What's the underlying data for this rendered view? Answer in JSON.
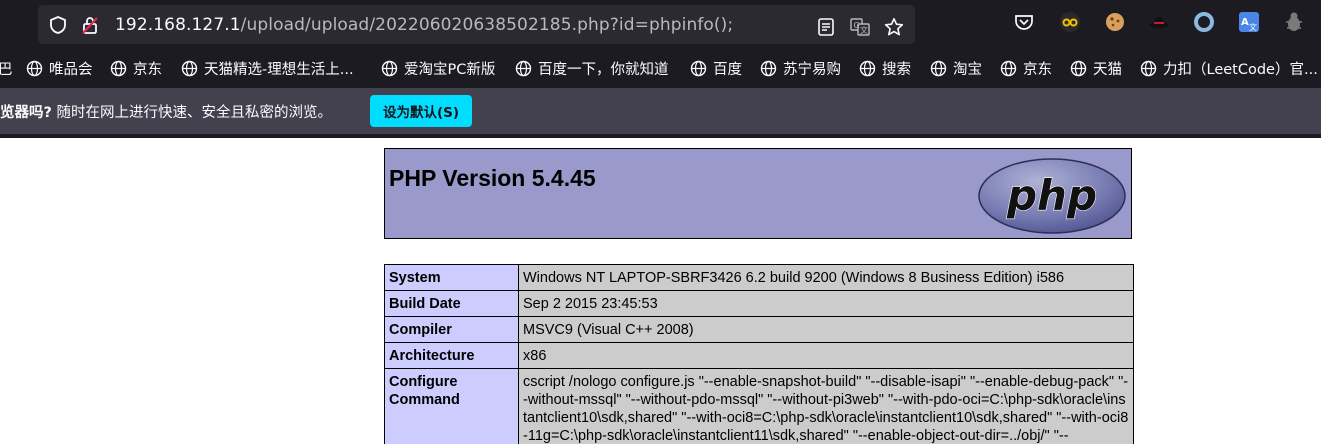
{
  "browser": {
    "url_host": "192.168.127.1",
    "url_path": "/upload/upload/202206020638502185.php?id=phpinfo();",
    "bookmarks": [
      {
        "label": "巴",
        "icon": "none"
      },
      {
        "label": "唯品会",
        "icon": "globe-icon"
      },
      {
        "label": "京东",
        "icon": "globe-icon"
      },
      {
        "label": "天猫精选-理想生活上...",
        "icon": "globe-icon"
      },
      {
        "label": "爱淘宝PC新版",
        "icon": "globe-icon"
      },
      {
        "label": "百度一下，你就知道",
        "icon": "globe-icon"
      },
      {
        "label": "百度",
        "icon": "globe-icon"
      },
      {
        "label": "苏宁易购",
        "icon": "globe-icon"
      },
      {
        "label": "搜索",
        "icon": "globe-icon"
      },
      {
        "label": "淘宝",
        "icon": "globe-icon"
      },
      {
        "label": "京东",
        "icon": "globe-icon"
      },
      {
        "label": "天猫",
        "icon": "globe-icon"
      },
      {
        "label": "力扣（LeetCode）官...",
        "icon": "globe-icon"
      }
    ],
    "notice": {
      "bold_text": "览器吗?",
      "text": " 随时在网上进行快速、安全且私密的浏览。",
      "button_label": "设为默认(S)"
    },
    "accent_color": "#00ddff"
  },
  "phpinfo": {
    "title": "PHP Version 5.4.45",
    "logo_text": "php",
    "rows": [
      {
        "key": "System",
        "value": "Windows NT LAPTOP-SBRF3426 6.2 build 9200 (Windows 8 Business Edition) i586"
      },
      {
        "key": "Build Date",
        "value": "Sep 2 2015 23:45:53"
      },
      {
        "key": "Compiler",
        "value": "MSVC9 (Visual C++ 2008)"
      },
      {
        "key": "Architecture",
        "value": "x86"
      },
      {
        "key": "Configure Command",
        "value": "cscript /nologo configure.js \"--enable-snapshot-build\" \"--disable-isapi\" \"--enable-debug-pack\" \"--without-mssql\" \"--without-pdo-mssql\" \"--without-pi3web\" \"--with-pdo-oci=C:\\php-sdk\\oracle\\instantclient10\\sdk,shared\" \"--with-oci8=C:\\php-sdk\\oracle\\instantclient10\\sdk,shared\" \"--with-oci8-11g=C:\\php-sdk\\oracle\\instantclient11\\sdk,shared\" \"--enable-object-out-dir=../obj/\" \"--"
      }
    ]
  }
}
